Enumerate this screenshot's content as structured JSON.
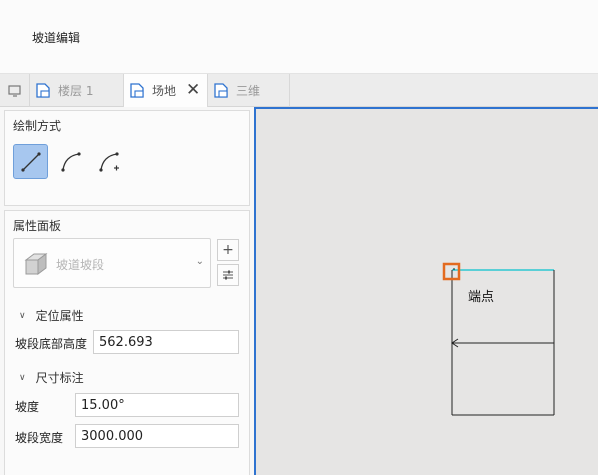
{
  "window": {
    "title": "坡道编辑"
  },
  "tabs": [
    {
      "label": "楼层 1",
      "active": false
    },
    {
      "label": "场地",
      "active": true
    },
    {
      "label": "三维",
      "active": false
    }
  ],
  "draw_panel": {
    "title": "绘制方式",
    "tools": [
      "line-tool",
      "arc-tool",
      "arc-add-tool"
    ]
  },
  "props_panel": {
    "title": "属性面板",
    "type_selector": "坡道坡段",
    "sections": {
      "position": {
        "title": "定位属性",
        "fields": [
          {
            "label": "坡段底部高度",
            "value": "562.693"
          }
        ]
      },
      "dimension": {
        "title": "尺寸标注",
        "fields": [
          {
            "label": "坡度",
            "value": "15.00°"
          },
          {
            "label": "坡段宽度",
            "value": "3000.000"
          }
        ]
      }
    }
  },
  "canvas": {
    "endpoint_label": "端点",
    "colors": {
      "highlight": "#2bc8d2",
      "marker": "#e36a1f",
      "border": "#2f73d0"
    }
  }
}
